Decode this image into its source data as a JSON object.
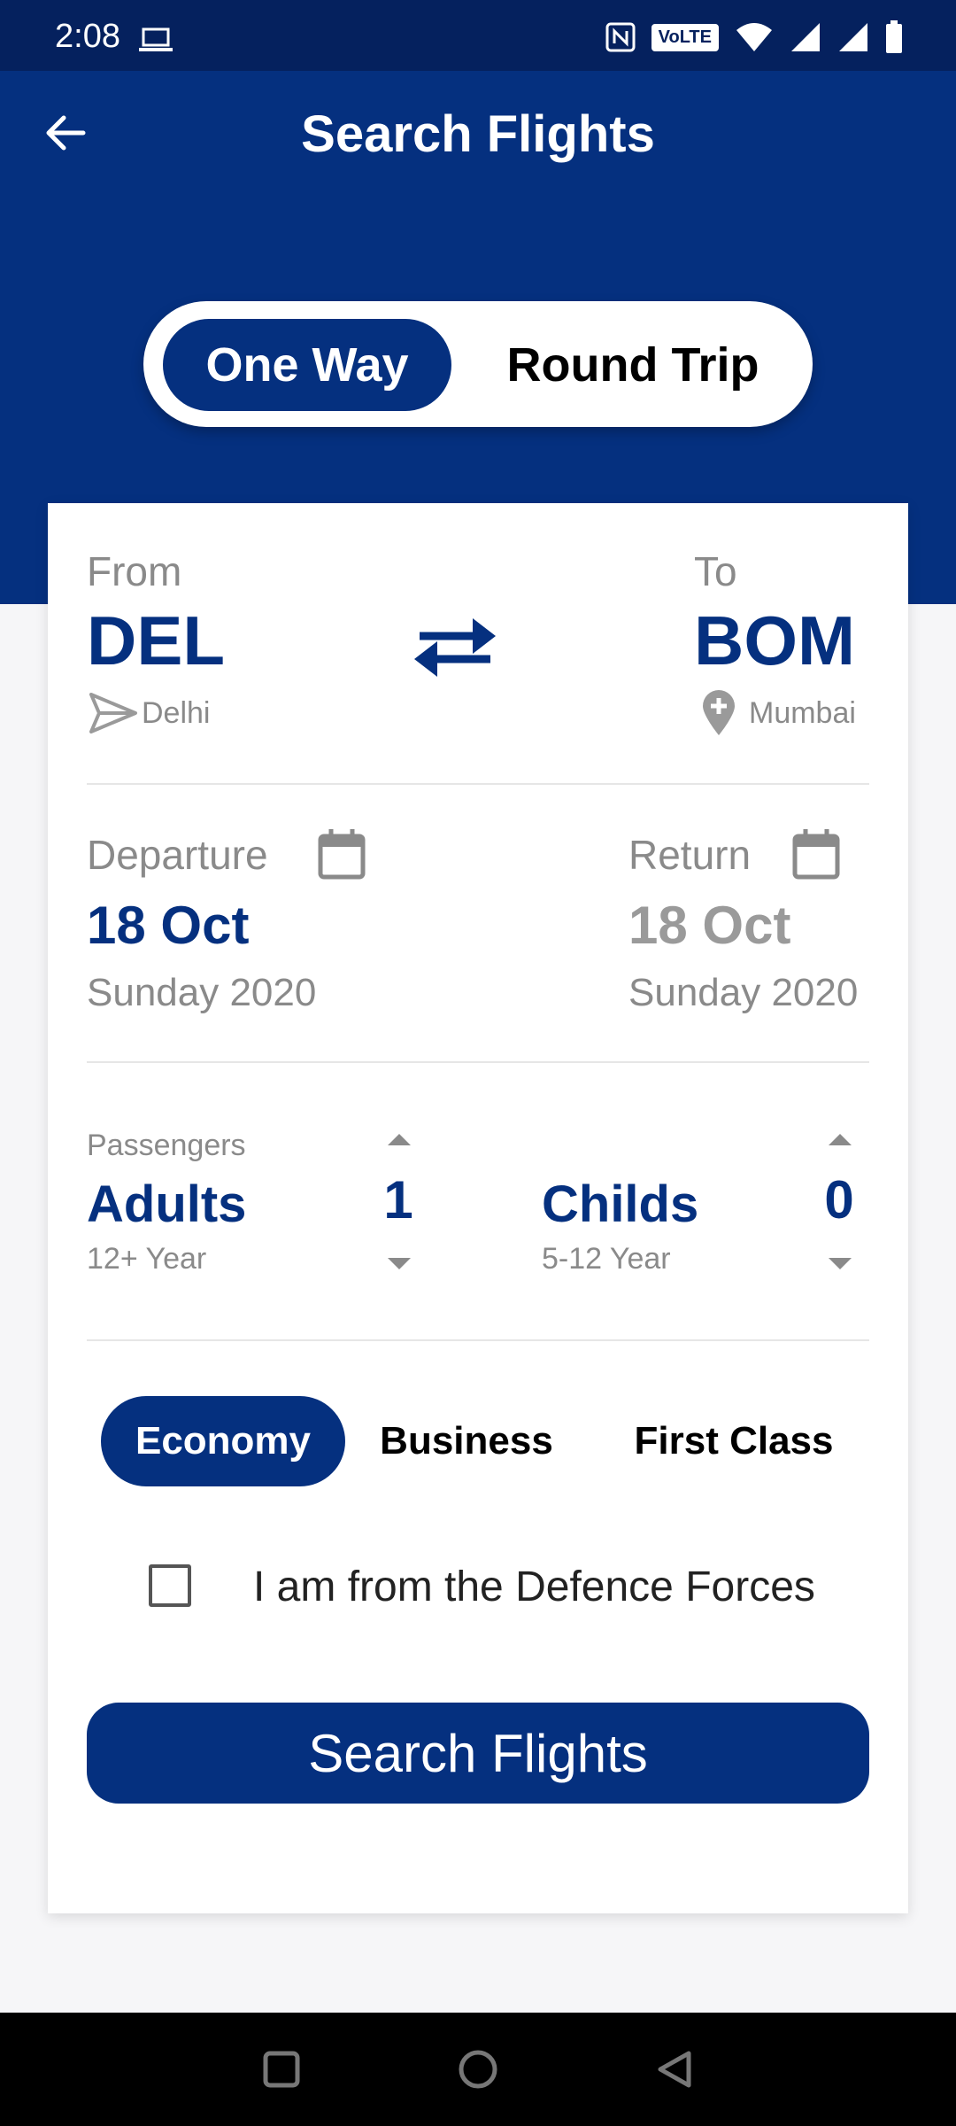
{
  "status_bar": {
    "time": "2:08",
    "volte": "VoLTE"
  },
  "header": {
    "title": "Search Flights"
  },
  "trip_type": {
    "selected": "One Way",
    "one_way": "One Way",
    "round_trip": "Round Trip"
  },
  "route": {
    "from_label": "From",
    "from_code": "DEL",
    "from_city": "Delhi",
    "to_label": "To",
    "to_code": "BOM",
    "to_city": "Mumbai"
  },
  "dates": {
    "departure_label": "Departure",
    "departure_date": "18 Oct",
    "departure_sub": "Sunday 2020",
    "return_label": "Return",
    "return_date": "18 Oct",
    "return_sub": "Sunday 2020"
  },
  "passengers": {
    "label": "Passengers",
    "adults_label": "Adults",
    "adults_age": "12+ Year",
    "adults_count": "1",
    "childs_label": "Childs",
    "childs_age": "5-12 Year",
    "childs_count": "0"
  },
  "cabin_class": {
    "selected": "Economy",
    "options": [
      "Economy",
      "Business",
      "First Class"
    ]
  },
  "defence": {
    "label": "I am from the Defence Forces",
    "checked": false
  },
  "search_button": {
    "label": "Search Flights"
  },
  "colors": {
    "primary": "#05307f",
    "status": "#05215e",
    "muted": "#8a8a8a"
  }
}
